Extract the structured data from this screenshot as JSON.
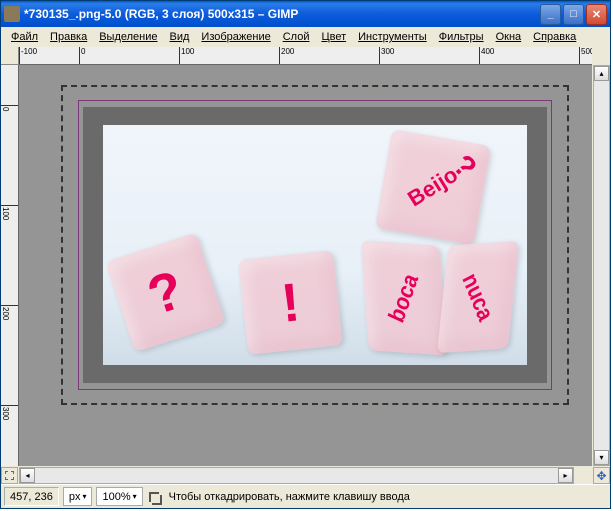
{
  "title": "*730135_.png-5.0 (RGB, 3 слоя) 500x315 – GIMP",
  "menu": {
    "file": "Файл",
    "edit": "Правка",
    "select": "Выделение",
    "view": "Вид",
    "image": "Изображение",
    "layer": "Слой",
    "color": "Цвет",
    "tools": "Инструменты",
    "filters": "Фильтры",
    "windows": "Окна",
    "help": "Справка"
  },
  "ruler_h": [
    "-100",
    "0",
    "100",
    "200",
    "300",
    "400",
    "500"
  ],
  "ruler_v": [
    "0",
    "100",
    "200",
    "300"
  ],
  "dice": {
    "d1": "?",
    "d2": "!",
    "d3_main": "Beijo",
    "d3_top": "?",
    "d4": "boca",
    "d5": "nuca"
  },
  "status": {
    "coords": "457, 236",
    "unit": "px",
    "zoom": "100%",
    "message": "Чтобы откадрировать, нажмите клавишу ввода"
  }
}
